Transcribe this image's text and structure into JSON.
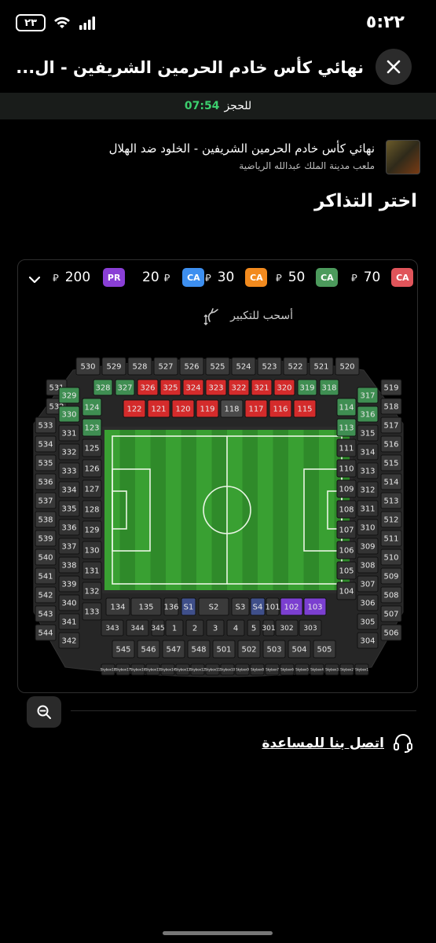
{
  "status": {
    "time": "٥:٢٢",
    "battery": "٢٣"
  },
  "header": {
    "title": "نهائي كأس خادم الحرمين الشريفين - ال..."
  },
  "timer": {
    "value": "07:54",
    "label": "للحجز"
  },
  "event": {
    "title": "نهائي كأس خادم الحرمين الشريفين - الخلود ضد الهلال",
    "venue": "ملعب مدينة الملك عبدالله الرياضية"
  },
  "section_title": "اختر التذاكر",
  "currency_symbol": "⃁",
  "price_tiers": [
    {
      "badge": "CA",
      "price": "70",
      "color": "#e0545a"
    },
    {
      "badge": "CA",
      "price": "50",
      "color": "#4c9a5c"
    },
    {
      "badge": "CA",
      "price": "30",
      "color": "#f28a1e"
    },
    {
      "badge": "CA",
      "price": "20",
      "color": "#3d8ff0"
    },
    {
      "badge": "PR",
      "price": "200",
      "color": "#8a3fd6"
    }
  ],
  "zoom_hint": "أسحب للتكبير",
  "support_label": "اتصل بنا للمساعدة",
  "section_colors": {
    "red": "#d42b2b",
    "green": "#3f8e52",
    "purple": "#7b3fd0",
    "blue": "#3f4f8a",
    "gray": "#3a3a3a"
  },
  "stadium_sections": {
    "upper_top": [
      "530",
      "529",
      "528",
      "527",
      "526",
      "525",
      "524",
      "523",
      "522",
      "521",
      "520"
    ],
    "red_300": [
      "326",
      "325",
      "324",
      "323",
      "322",
      "321",
      "320"
    ],
    "green_300_left": [
      "328",
      "327"
    ],
    "green_300_right": [
      "319",
      "318"
    ],
    "red_100": [
      "122",
      "121",
      "120",
      "119",
      "117",
      "116",
      "115"
    ],
    "gray_118": "118",
    "left_upper": [
      "531",
      "532",
      "533",
      "534",
      "535",
      "536",
      "537",
      "538",
      "539",
      "540",
      "541",
      "542",
      "543",
      "544"
    ],
    "left_mid": [
      "329",
      "330",
      "331",
      "332",
      "333",
      "334",
      "335",
      "336",
      "337",
      "338",
      "339",
      "340",
      "341",
      "342"
    ],
    "left_low": [
      "124",
      "123",
      "125",
      "126",
      "127",
      "128",
      "129",
      "130",
      "131",
      "132",
      "133"
    ],
    "right_upper": [
      "519",
      "518",
      "517",
      "516",
      "515",
      "514",
      "513",
      "512",
      "511",
      "510",
      "509",
      "508",
      "507",
      "506"
    ],
    "right_mid": [
      "317",
      "316",
      "315",
      "314",
      "313",
      "312",
      "311",
      "310",
      "309",
      "308",
      "307",
      "306",
      "305",
      "304"
    ],
    "right_low": [
      "114",
      "113",
      "111",
      "110",
      "109",
      "108",
      "107",
      "106",
      "105",
      "104"
    ],
    "bottom_row1": [
      "134",
      "135",
      "136",
      "S1",
      "S2",
      "S3",
      "S4",
      "101",
      "102",
      "103"
    ],
    "bottom_row2": [
      "343",
      "344",
      "345",
      "1",
      "2",
      "3",
      "4",
      "5",
      "301",
      "302",
      "303"
    ],
    "bottom_row3": [
      "545",
      "546",
      "547",
      "548",
      "501",
      "502",
      "503",
      "504",
      "505"
    ],
    "skyboxes": [
      "Skybox18",
      "Skybox17",
      "Skybox16",
      "Skybox15",
      "Skybox14",
      "Skybox13",
      "Skybox12",
      "Skybox11",
      "Skybox10",
      "Skybox9",
      "Skybox8",
      "Skybox7",
      "Skybox6",
      "Skybox5",
      "Skybox4",
      "Skybox3",
      "Skybox2",
      "Skybox1"
    ]
  }
}
